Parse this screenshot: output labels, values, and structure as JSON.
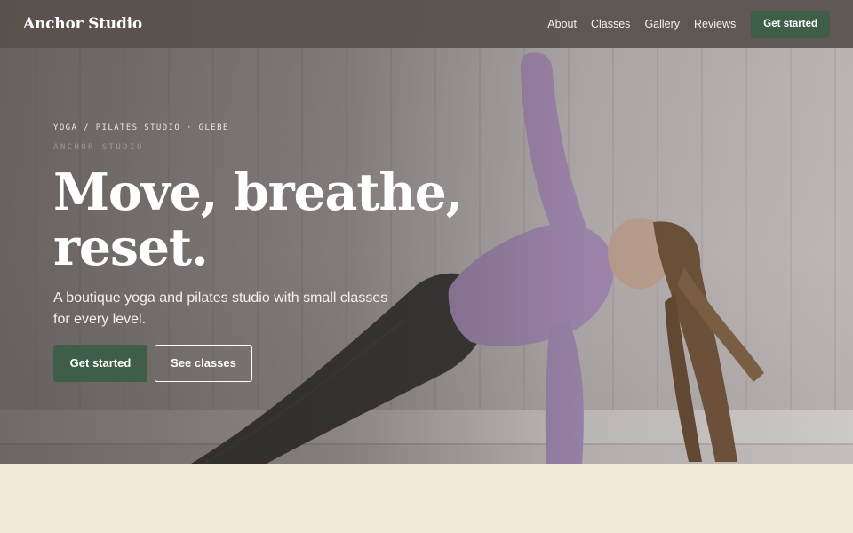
{
  "nav": {
    "brand": "Anchor Studio",
    "links": [
      "About",
      "Classes",
      "Gallery",
      "Reviews"
    ],
    "cta": "Get started"
  },
  "hero": {
    "eyebrow": "YOGA / PILATES STUDIO · GLEBE",
    "sub_eyebrow": "ANCHOR STUDIO",
    "headline": "Move, breathe, reset.",
    "lead": "A boutique yoga and pilates studio with small classes for every level.",
    "primary_cta": "Get started",
    "secondary_cta": "See classes",
    "image_subject": "yoga-side-plank-photo"
  },
  "colors": {
    "accent": "#3e5e47",
    "nav_bg": "#58504c",
    "page_bg": "#f1e7d9",
    "text_on_dark": "#ffffff"
  }
}
